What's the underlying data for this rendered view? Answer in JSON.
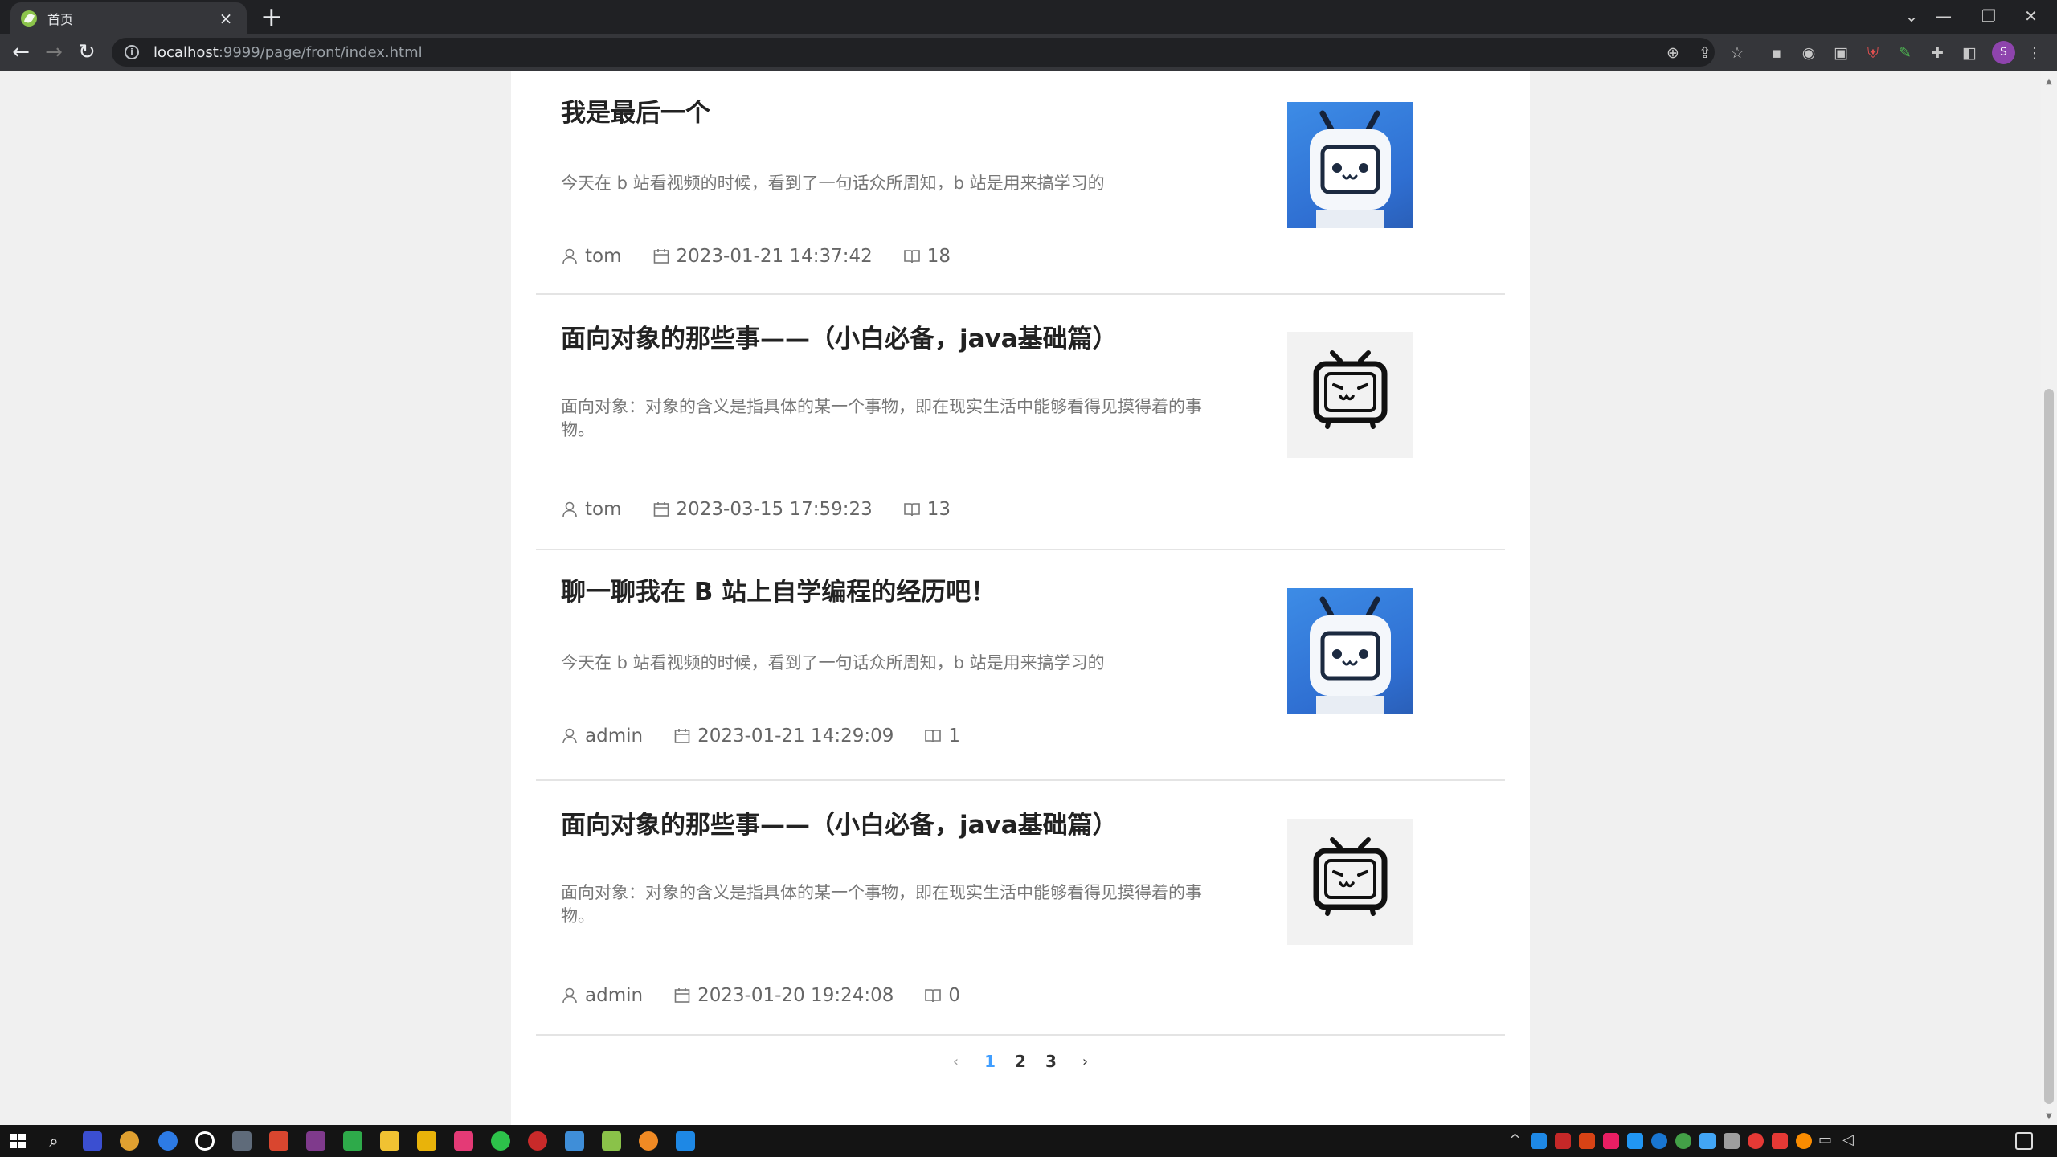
{
  "browser": {
    "tab_title": "首页",
    "tab_close": "×",
    "new_tab": "+",
    "url_host": "localhost",
    "url_path": ":9999/page/front/index.html"
  },
  "articles": [
    {
      "title": "我是最后一个",
      "summary": "今天在 b 站看视频的时候，看到了一句话众所周知，b 站是用来搞学习的",
      "author": "tom",
      "date": "2023-01-21 14:37:42",
      "views": "18",
      "image": "bilibili-mascot-blue"
    },
    {
      "title": "面向对象的那些事——（小白必备，java基础篇）",
      "summary": "面向对象：对象的含义是指具体的某一个事物，即在现实生活中能够看得见摸得着的事物。",
      "author": "tom",
      "date": "2023-03-15 17:59:23",
      "views": "13",
      "image": "bilibili-tv-icon"
    },
    {
      "title": "聊一聊我在 B 站上自学编程的经历吧！",
      "summary": "今天在 b 站看视频的时候，看到了一句话众所周知，b 站是用来搞学习的",
      "author": "admin",
      "date": "2023-01-21 14:29:09",
      "views": "1",
      "image": "bilibili-mascot-blue"
    },
    {
      "title": "面向对象的那些事——（小白必备，java基础篇）",
      "summary": "面向对象：对象的含义是指具体的某一个事物，即在现实生活中能够看得见摸得着的事物。",
      "author": "admin",
      "date": "2023-01-20 19:24:08",
      "views": "0",
      "image": "bilibili-tv-icon"
    }
  ],
  "pagination": {
    "pages": [
      "1",
      "2",
      "3"
    ],
    "current": "1",
    "prev": "‹",
    "next": "›"
  },
  "colors": {
    "accent": "#409eff",
    "title": "#222222",
    "summary": "#777777",
    "chrome_bg": "#202124",
    "toolbar_bg": "#35363a"
  }
}
